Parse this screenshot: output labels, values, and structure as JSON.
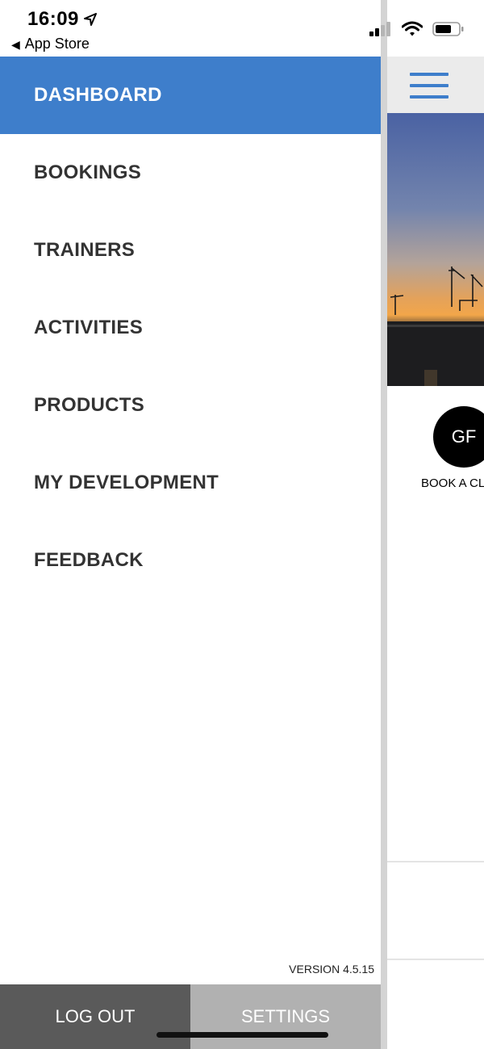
{
  "status_bar": {
    "time": "16:09",
    "back_label": "App Store",
    "icons": [
      "location-arrow-icon",
      "cellular-signal-icon",
      "wifi-icon",
      "battery-icon"
    ]
  },
  "menu": {
    "items": [
      {
        "label": "DASHBOARD",
        "active": true
      },
      {
        "label": "BOOKINGS"
      },
      {
        "label": "TRAINERS"
      },
      {
        "label": "ACTIVITIES"
      },
      {
        "label": "PRODUCTS"
      },
      {
        "label": "MY DEVELOPMENT"
      },
      {
        "label": "FEEDBACK"
      }
    ]
  },
  "version": "VERSION 4.5.15",
  "footer": {
    "logout_label": "LOG OUT",
    "settings_label": "SETTINGS"
  },
  "dashboard": {
    "avatar_initials": "GF",
    "avatar_label": "BOOK A CL"
  },
  "colors": {
    "accent": "#3e7ecb",
    "logout_bg": "#5a5a5a",
    "settings_bg": "#b1b1b1"
  }
}
